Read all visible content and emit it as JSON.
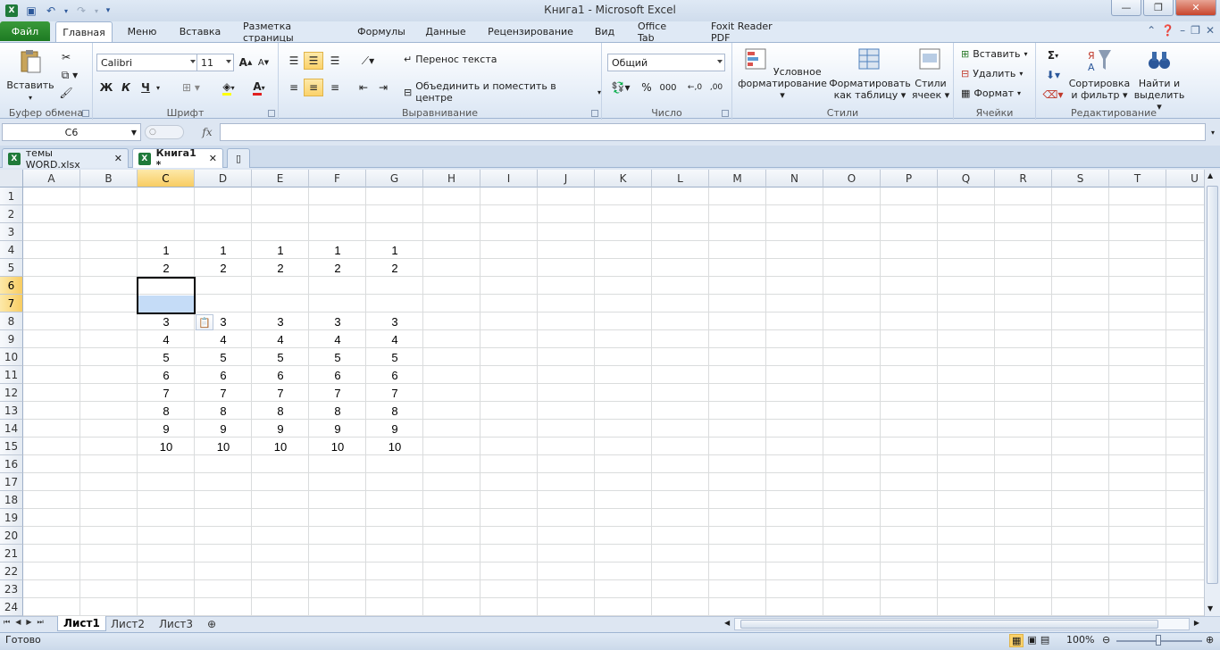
{
  "window": {
    "title": "Книга1  -  Microsoft Excel"
  },
  "ribbon_tabs": [
    "Файл",
    "Главная",
    "Меню",
    "Вставка",
    "Разметка страницы",
    "Формулы",
    "Данные",
    "Рецензирование",
    "Вид",
    "Office Tab",
    "Foxit Reader PDF"
  ],
  "clipboard": {
    "paste": "Вставить",
    "label": "Буфер обмена"
  },
  "font": {
    "name": "Calibri",
    "size": "11",
    "bold": "Ж",
    "italic": "К",
    "underline": "Ч",
    "grow": "A",
    "shrink": "A",
    "color_letter": "A",
    "label": "Шрифт"
  },
  "alignment": {
    "wrap": "Перенос текста",
    "merge": "Объединить и поместить в центре",
    "label": "Выравнивание"
  },
  "number": {
    "format": "Общий",
    "percent": "%",
    "thousands": "000",
    "inc": "←,0",
    "dec": ",00",
    "label": "Число"
  },
  "styles": {
    "conditional": "Условное форматирование",
    "table": "Форматировать как таблицу",
    "cell": "Стили ячеек",
    "label": "Стили"
  },
  "cells_group": {
    "insert": "Вставить",
    "delete": "Удалить",
    "format": "Формат",
    "label": "Ячейки"
  },
  "editing": {
    "sort": "Сортировка и фильтр",
    "find": "Найти и выделить",
    "sigma": "Σ",
    "label": "Редактирование"
  },
  "formula_bar": {
    "name_box": "C6",
    "fx": "fx",
    "value": ""
  },
  "doc_tabs": [
    {
      "name": "темы WORD.xlsx"
    },
    {
      "name": "Книга1 *"
    }
  ],
  "columns": [
    "A",
    "B",
    "C",
    "D",
    "E",
    "F",
    "G",
    "H",
    "I",
    "J",
    "K",
    "L",
    "M",
    "N",
    "O",
    "P",
    "Q",
    "R",
    "S",
    "T",
    "U"
  ],
  "rows": [
    "1",
    "2",
    "3",
    "4",
    "5",
    "6",
    "7",
    "8",
    "9",
    "10",
    "11",
    "12",
    "13",
    "14",
    "15",
    "16",
    "17",
    "18",
    "19",
    "20",
    "21",
    "22",
    "23",
    "24"
  ],
  "cells": {
    "4": [
      "1",
      "1",
      "1",
      "1",
      "1"
    ],
    "5": [
      "2",
      "2",
      "2",
      "2",
      "2"
    ],
    "8": [
      "3",
      "3",
      "3",
      "3",
      "3"
    ],
    "9": [
      "4",
      "4",
      "4",
      "4",
      "4"
    ],
    "10": [
      "5",
      "5",
      "5",
      "5",
      "5"
    ],
    "11": [
      "6",
      "6",
      "6",
      "6",
      "6"
    ],
    "12": [
      "7",
      "7",
      "7",
      "7",
      "7"
    ],
    "13": [
      "8",
      "8",
      "8",
      "8",
      "8"
    ],
    "14": [
      "9",
      "9",
      "9",
      "9",
      "9"
    ],
    "15": [
      "10",
      "10",
      "10",
      "10",
      "10"
    ]
  },
  "selected": {
    "column": "C",
    "rows": [
      "6",
      "7"
    ]
  },
  "sheets": [
    "Лист1",
    "Лист2",
    "Лист3"
  ],
  "status": {
    "ready": "Готово",
    "zoom": "100%"
  }
}
